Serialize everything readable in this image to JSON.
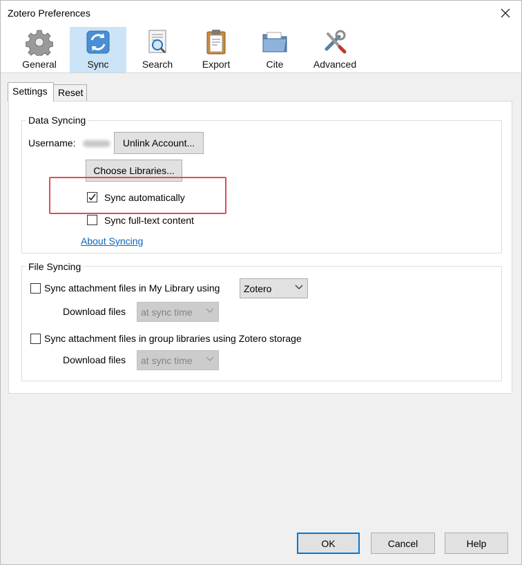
{
  "window": {
    "title": "Zotero Preferences"
  },
  "toolbar": {
    "panes": [
      {
        "label": "General",
        "icon": "gear-icon"
      },
      {
        "label": "Sync",
        "icon": "sync-icon",
        "selected": true
      },
      {
        "label": "Search",
        "icon": "search-icon"
      },
      {
        "label": "Export",
        "icon": "clipboard-icon"
      },
      {
        "label": "Cite",
        "icon": "folder-icon"
      },
      {
        "label": "Advanced",
        "icon": "tools-icon"
      }
    ]
  },
  "tabs": [
    {
      "label": "Settings",
      "active": true
    },
    {
      "label": "Reset",
      "active": false
    }
  ],
  "data_syncing": {
    "legend": "Data Syncing",
    "username_label": "Username:",
    "unlink_button": "Unlink Account...",
    "choose_libraries_button": "Choose Libraries...",
    "sync_automatically": {
      "label": "Sync automatically",
      "checked": true
    },
    "sync_fulltext": {
      "label": "Sync full-text content",
      "checked": false
    },
    "about_link": "About Syncing"
  },
  "file_syncing": {
    "legend": "File Syncing",
    "my_library": {
      "label": "Sync attachment files in My Library using",
      "checked": false,
      "service": "Zotero",
      "download_label": "Download files",
      "download_value": "at sync time"
    },
    "group_libraries": {
      "label": "Sync attachment files in group libraries using Zotero storage",
      "checked": false,
      "download_label": "Download files",
      "download_value": "at sync time"
    }
  },
  "footer": {
    "ok": "OK",
    "cancel": "Cancel",
    "help": "Help"
  },
  "colors": {
    "selected_pane_bg": "#cce4f7",
    "link": "#0b63b9",
    "highlight_box": "#e04c51",
    "default_button_border": "#0078d7"
  }
}
